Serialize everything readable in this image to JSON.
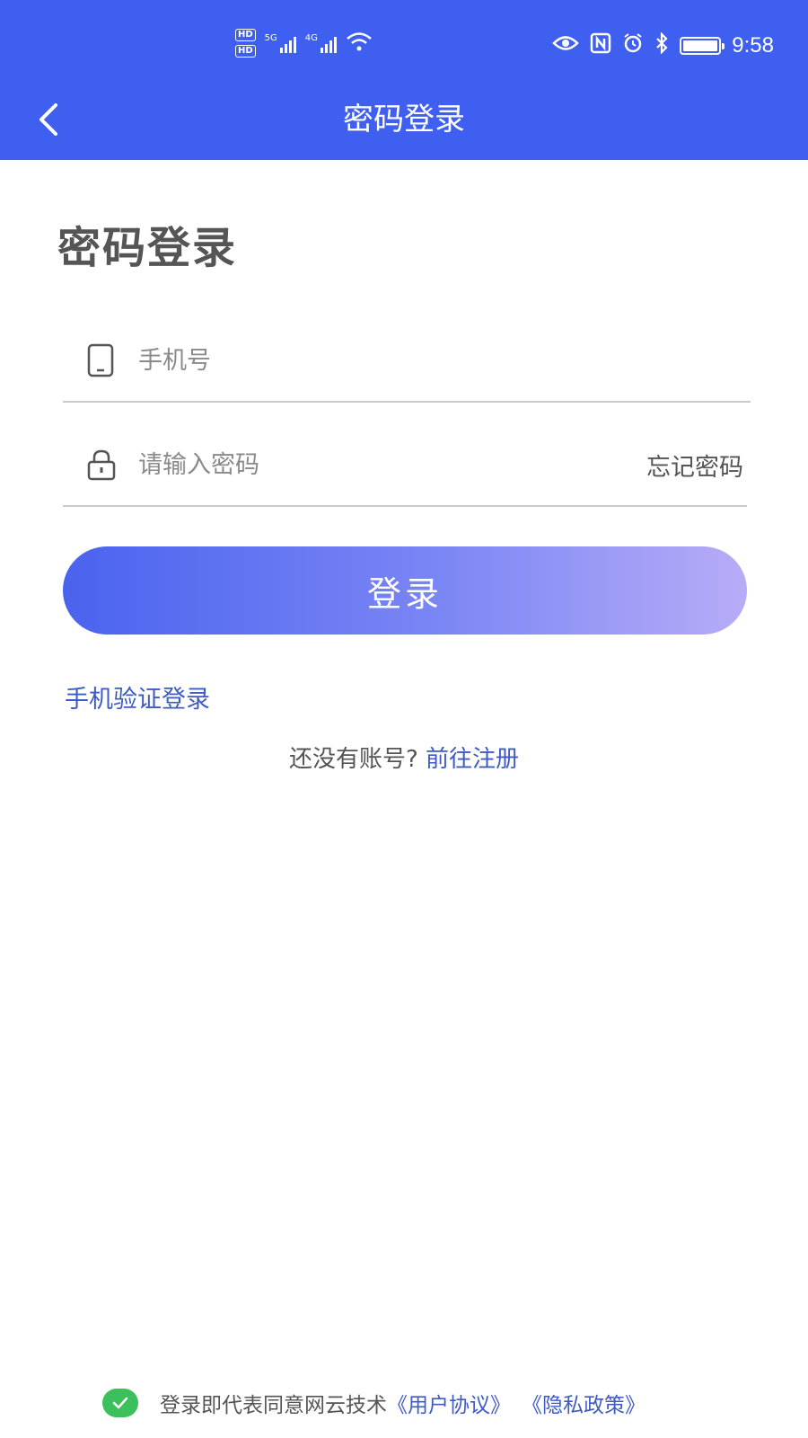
{
  "status_bar": {
    "hd1": "HD",
    "hd2": "HD",
    "network1": "5G",
    "network2": "4G",
    "time": "9:58"
  },
  "nav": {
    "title": "密码登录",
    "back_icon": "chevron-left-icon"
  },
  "page": {
    "heading": "密码登录"
  },
  "form": {
    "phone_placeholder": "手机号",
    "phone_icon": "phone-icon",
    "password_placeholder": "请输入密码",
    "password_icon": "lock-icon",
    "forgot_label": "忘记密码"
  },
  "actions": {
    "login_label": "登录",
    "sms_login_label": "手机验证登录",
    "no_account_text": "还没有账号?",
    "register_link": "前往注册"
  },
  "agreement": {
    "checked": true,
    "prefix": "登录即代表同意网云技术",
    "user_agreement": "《用户协议》",
    "privacy_policy": "《隐私政策》"
  },
  "colors": {
    "primary": "#3f5ff0",
    "link": "#3f5bc4",
    "check": "#3bc05c"
  }
}
